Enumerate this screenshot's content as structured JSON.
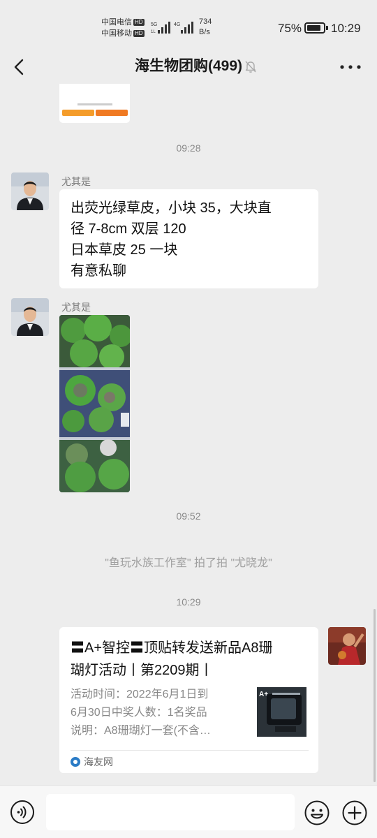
{
  "status_bar": {
    "carrier_1": "中国电信",
    "carrier_2": "中国移动",
    "hd_badge": "HD",
    "net_speed_value": "734",
    "net_speed_unit": "B/s",
    "battery_percent": "75%",
    "time": "10:29"
  },
  "header": {
    "title": "海生物团购(499)",
    "muted": true
  },
  "messages": {
    "time_1": "09:28",
    "msg1": {
      "sender": "尤其是",
      "lines": [
        "出荧光绿草皮，小块 35，大块直",
        "径 7-8cm 双层 120",
        "日本草皮 25 一块",
        "有意私聊"
      ]
    },
    "msg2": {
      "sender": "尤其是",
      "image_subject": "green coral frags in aquarium"
    },
    "time_2": "09:52",
    "system_pat": "\"鱼玩水族工作室\" 拍了拍 \"尤晓龙\"",
    "time_3": "10:29",
    "link_card": {
      "title_lines": [
        "〓A+智控〓顶贴转发送新品A8珊",
        "瑚灯活动丨第2209期丨"
      ],
      "desc_lines": [
        "活动时间：2022年6月1日到",
        "6月30日中奖人数：1名奖品",
        "说明：A8珊瑚灯一套(不含…"
      ],
      "source": "海友网",
      "thumb_label": "A+"
    }
  },
  "input": {
    "placeholder": ""
  },
  "colors": {
    "chat_background": "#ededed",
    "bubble": "#ffffff",
    "secondary_text": "#8a8a8a"
  }
}
